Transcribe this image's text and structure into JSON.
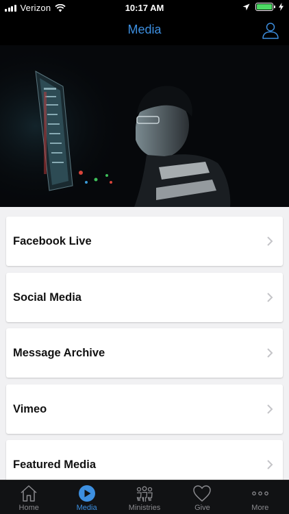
{
  "status_bar": {
    "carrier": "Verizon",
    "time": "10:17 AM",
    "battery_color": "#4cd964"
  },
  "nav": {
    "title": "Media",
    "profile_icon": "person-icon",
    "accent_color": "#3d8fe0"
  },
  "hero": {
    "icon": "hero-image"
  },
  "menu": {
    "items": [
      {
        "label": "Facebook Live"
      },
      {
        "label": "Social Media"
      },
      {
        "label": "Message Archive"
      },
      {
        "label": "Vimeo"
      },
      {
        "label": "Featured Media"
      }
    ]
  },
  "tabs": [
    {
      "label": "Home",
      "icon": "home-icon",
      "active": false
    },
    {
      "label": "Media",
      "icon": "play-icon",
      "active": true
    },
    {
      "label": "Ministries",
      "icon": "people-icon",
      "active": false
    },
    {
      "label": "Give",
      "icon": "heart-icon",
      "active": false
    },
    {
      "label": "More",
      "icon": "more-icon",
      "active": false
    }
  ]
}
